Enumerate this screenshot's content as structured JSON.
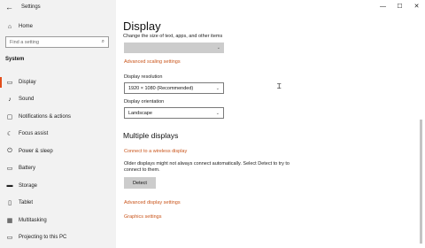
{
  "window": {
    "title": "Settings",
    "controls": {
      "minimize": "—",
      "maximize": "☐",
      "close": "✕"
    }
  },
  "sidebar": {
    "back_icon": "←",
    "home": {
      "label": "Home",
      "icon": "⌂"
    },
    "search": {
      "placeholder": "Find a setting",
      "icon": "⌕"
    },
    "section": "System",
    "items": [
      {
        "label": "Display",
        "icon": "▭",
        "selected": true
      },
      {
        "label": "Sound",
        "icon": "♪"
      },
      {
        "label": "Notifications & actions",
        "icon": "▢"
      },
      {
        "label": "Focus assist",
        "icon": "☾"
      },
      {
        "label": "Power & sleep",
        "icon": "⏻"
      },
      {
        "label": "Battery",
        "icon": "▭"
      },
      {
        "label": "Storage",
        "icon": "▬"
      },
      {
        "label": "Tablet",
        "icon": "▯"
      },
      {
        "label": "Multitasking",
        "icon": "▦"
      },
      {
        "label": "Projecting to this PC",
        "icon": "▭"
      }
    ]
  },
  "main": {
    "title": "Display",
    "scale_label": "Change the size of text, apps, and other items",
    "advanced_scaling_link": "Advanced scaling settings",
    "resolution": {
      "label": "Display resolution",
      "value": "1920 × 1080 (Recommended)"
    },
    "orientation": {
      "label": "Display orientation",
      "value": "Landscape"
    },
    "multiple_displays": {
      "heading": "Multiple displays",
      "wireless_link": "Connect to a wireless display",
      "description": "Older displays might not always connect automatically. Select Detect to try to connect to them.",
      "detect_button": "Detect"
    },
    "advanced_display_link": "Advanced display settings",
    "graphics_link": "Graphics settings",
    "chevron": "⌄"
  },
  "colors": {
    "accent": "#c9541a",
    "sidebar_bg": "#f2f2f2",
    "selected_marker": "#e24d1b"
  }
}
